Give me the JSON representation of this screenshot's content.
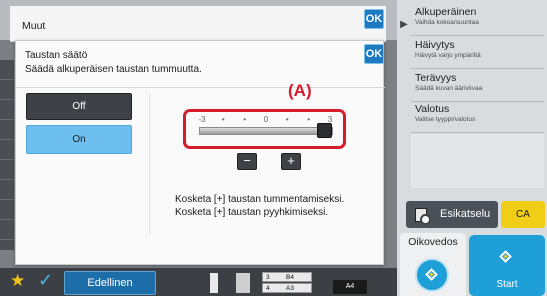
{
  "colors": {
    "accent_blue": "#1d79c0",
    "highlight_red": "#d61b2c",
    "selected_option": "#6cbfee",
    "ca_yellow": "#f0ce17"
  },
  "header": {
    "title": "Muut",
    "ok_label": "OK"
  },
  "dialog": {
    "title": "Taustan säätö",
    "subtitle": "Säädä alkuperäisen taustan tummuutta.",
    "ok_label": "OK",
    "options": {
      "off_label": "Off",
      "on_label": "On",
      "selected": "On"
    },
    "callout": "(A)",
    "slider": {
      "tick_labels": [
        "-3",
        "•",
        "•",
        "0",
        "•",
        "•",
        "3"
      ],
      "min": -3,
      "max": 3,
      "value": 3
    },
    "minus_label": "−",
    "plus_label": "+",
    "instructions": [
      "Kosketa [+] taustan tummentamiseksi.",
      "Kosketa [+] taustan pyyhkimiseksi."
    ]
  },
  "right_panel": {
    "items": [
      {
        "title": "Alkuperäinen",
        "subtitle": "Vaihda kokoa/suuntaa"
      },
      {
        "title": "Häivytys",
        "subtitle": "Häivytä varjo ympäriltä"
      },
      {
        "title": "Terävyys",
        "subtitle": "Säädä kuvan ääriviivaa"
      },
      {
        "title": "Valotus",
        "subtitle": "Valitse tyyppi/valotus"
      }
    ],
    "preview_label": "Esikatselu",
    "ca_label": "CA",
    "proof_label": "Oikovedos",
    "start_label": "Start"
  },
  "bottom_bar": {
    "previous_label": "Edellinen",
    "tray_rows": [
      {
        "num": "3",
        "size": "B4"
      },
      {
        "num": "4",
        "size": "A3"
      }
    ],
    "paper_size": "A4"
  }
}
